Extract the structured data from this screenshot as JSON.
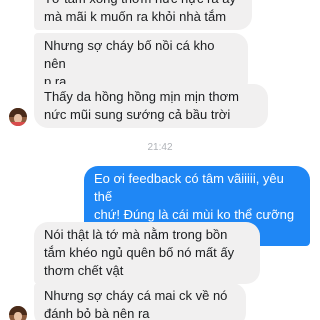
{
  "conversation": {
    "incoming_1": {
      "msg1": "Tớ tắm xong thơm nức nực ra ấy\nmà mãi k muốn ra khỏi nhà tắm",
      "msg2": "Nhưng sợ cháy bố nồi cá kho nên\np ra",
      "msg3": "Thấy da hồng hồng mịn mịn thơm\nnức mũi sung sướng cả bầu trời"
    },
    "timestamp": "21:42",
    "outgoing": {
      "msg1": "Eo ơi feedback có tâm vãiiiii, yêu thế\nchứ! Đúng là cái mùi ko thể cưỡng đc"
    },
    "incoming_2": {
      "msg1": "Nói thật là tớ mà nằm trong bồn\ntắm khéo ngủ quên bố nó mất ấy\nthơm chết vật",
      "msg2": "Nhưng sợ cháy cá mai ck về nó\nđánh bỏ bà nên ra"
    }
  },
  "colors": {
    "incoming_bubble": "#f1f0f0",
    "outgoing_bubble": "#1f87f5",
    "timestamp_text": "#b0b3b8"
  }
}
